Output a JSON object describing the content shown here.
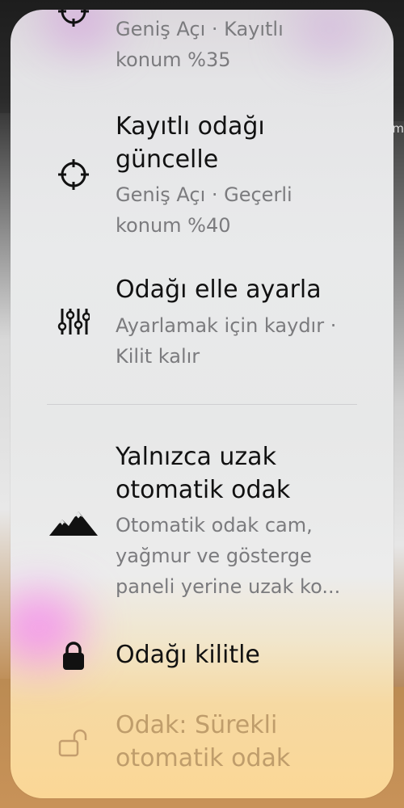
{
  "background": {
    "edge_text": "m"
  },
  "menu": {
    "items": [
      {
        "id": "wide-saved",
        "subtitle_line1": "Geniş Açı · Kayıtlı",
        "subtitle_line2": "konum %35",
        "icon": "crosshair-icon"
      },
      {
        "id": "update-focus",
        "title_line1": "Kayıtlı odağı",
        "title_line2": "güncelle",
        "subtitle_line1": "Geniş Açı · Geçerli",
        "subtitle_line2": "konum %40",
        "icon": "crosshair-icon"
      },
      {
        "id": "manual-focus",
        "title_line1": "Odağı elle ayarla",
        "subtitle_line1": "Ayarlamak için kaydır ·",
        "subtitle_line2": "Kilit kalır",
        "icon": "sliders-icon"
      },
      {
        "id": "far-autofocus",
        "title_line1": "Yalnızca uzak",
        "title_line2": "otomatik odak",
        "subtitle_line1": "Otomatik odak cam,",
        "subtitle_line2": "yağmur ve gösterge",
        "subtitle_line3": "paneli yerine uzak ko...",
        "icon": "mountains-icon"
      },
      {
        "id": "lock-focus",
        "title_line1": "Odağı kilitle",
        "icon": "lock-icon"
      },
      {
        "id": "focus-continuous",
        "title_line1": "Odak: Sürekli",
        "title_line2": "otomatik odak",
        "icon": "unlock-icon"
      }
    ]
  },
  "colors": {
    "title": "#111111",
    "subtitle": "#7b7b7e",
    "disabled": "#bf9d6b"
  }
}
